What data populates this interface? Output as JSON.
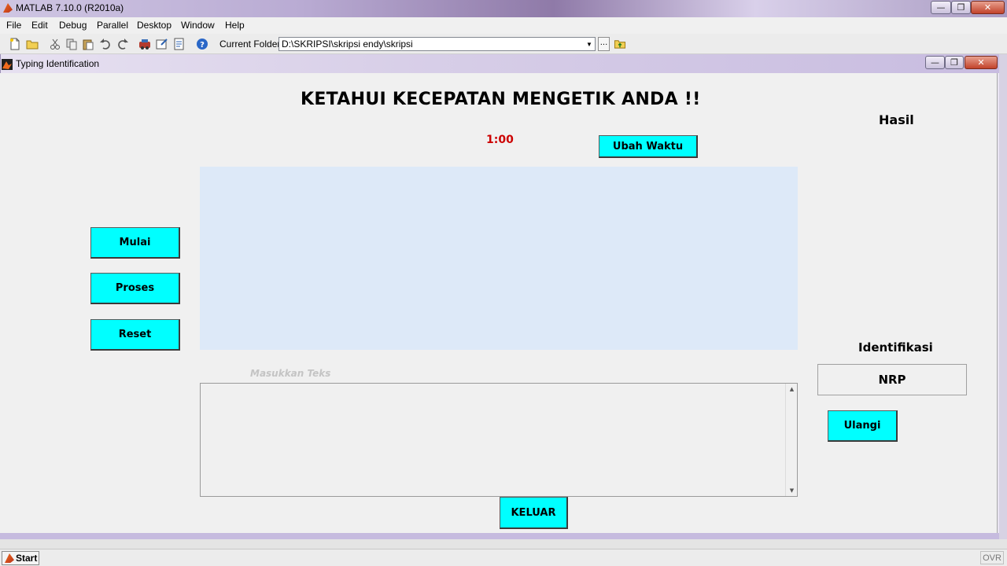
{
  "main_window": {
    "title": "MATLAB  7.10.0 (R2010a)",
    "caption_buttons": [
      "minimize",
      "restore",
      "close"
    ]
  },
  "menu": {
    "items": [
      "File",
      "Edit",
      "Debug",
      "Parallel",
      "Desktop",
      "Window",
      "Help"
    ]
  },
  "toolbar": {
    "icons": [
      "new-file-icon",
      "open-folder-icon",
      "cut-icon",
      "copy-icon",
      "paste-icon",
      "undo-icon",
      "redo-icon",
      "simulink-icon",
      "guide-icon",
      "profiler-icon",
      "help-icon"
    ],
    "current_folder_label": "Current Folder:",
    "current_folder_value": "D:\\SKRIPSI\\skripsi endy\\skripsi",
    "browse_label": "..."
  },
  "figure": {
    "title": "Typing Identification",
    "heading": "KETAHUI KECEPATAN MENGETIK ANDA !!",
    "timer": "1:00",
    "change_time_button": "Ubah Waktu",
    "start_button": "Mulai",
    "process_button": "Proses",
    "reset_button": "Reset",
    "input_label": "Masukkan Teks",
    "input_value": "",
    "result_label": "Hasil",
    "identification_label": "Identifikasi",
    "nrp_value": "NRP",
    "retry_button": "Ulangi",
    "exit_button": "KELUAR"
  },
  "statusbar": {
    "start_label": "Start",
    "mode_indicator": "OVR"
  },
  "colors": {
    "button_bg": "#00ffff",
    "timer": "#cc0000",
    "text_display_bg": "#dde9f8",
    "figure_bg": "#f0f0f0"
  }
}
